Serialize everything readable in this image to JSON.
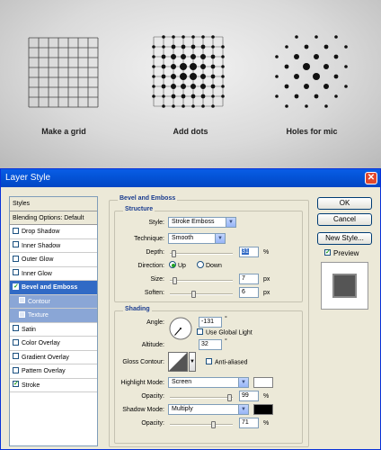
{
  "illustration": {
    "captions": [
      "Make a grid",
      "Add dots",
      "Holes for mic"
    ]
  },
  "dialog": {
    "title": "Layer Style",
    "close_glyph": "✕",
    "styles_list": [
      {
        "label": "Styles",
        "type": "head"
      },
      {
        "label": "Blending Options: Default",
        "type": "head"
      },
      {
        "label": "Drop Shadow",
        "checked": false
      },
      {
        "label": "Inner Shadow",
        "checked": false
      },
      {
        "label": "Outer Glow",
        "checked": false
      },
      {
        "label": "Inner Glow",
        "checked": false
      },
      {
        "label": "Bevel and Emboss",
        "checked": true,
        "selected": true
      },
      {
        "label": "Contour",
        "checked": false,
        "sub": true
      },
      {
        "label": "Texture",
        "checked": false,
        "sub": true
      },
      {
        "label": "Satin",
        "checked": false
      },
      {
        "label": "Color Overlay",
        "checked": false
      },
      {
        "label": "Gradient Overlay",
        "checked": false
      },
      {
        "label": "Pattern Overlay",
        "checked": false
      },
      {
        "label": "Stroke",
        "checked": true
      }
    ],
    "buttons": {
      "ok": "OK",
      "cancel": "Cancel",
      "new_style": "New Style..."
    },
    "preview_label": "Preview",
    "preview_checked": true,
    "bevel": {
      "group_title": "Bevel and Emboss",
      "structure_title": "Structure",
      "style_label": "Style:",
      "style_value": "Stroke Emboss",
      "technique_label": "Technique:",
      "technique_value": "Smooth",
      "depth_label": "Depth:",
      "depth_value": "31",
      "depth_unit": "%",
      "depth_level": 0.03,
      "direction_label": "Direction:",
      "dir_up": "Up",
      "dir_down": "Down",
      "direction_value": "Up",
      "size_label": "Size:",
      "size_value": "7",
      "size_unit": "px",
      "size_level": 0.05,
      "soften_label": "Soften:",
      "soften_value": "6",
      "soften_unit": "px",
      "soften_level": 0.37
    },
    "shading": {
      "title": "Shading",
      "angle_label": "Angle:",
      "angle_value": "-131",
      "angle_unit": "°",
      "global_light_label": "Use Global Light",
      "global_light": false,
      "altitude_label": "Altitude:",
      "altitude_value": "32",
      "altitude_unit": "°",
      "gloss_label": "Gloss Contour:",
      "anti_aliased_label": "Anti-aliased",
      "anti_aliased": false,
      "highlight_label": "Highlight Mode:",
      "highlight_value": "Screen",
      "highlight_color": "#ffffff",
      "hl_opacity_label": "Opacity:",
      "hl_opacity_value": "99",
      "hl_opacity_unit": "%",
      "hl_opacity_level": 0.99,
      "shadow_label": "Shadow Mode:",
      "shadow_value": "Multiply",
      "shadow_color": "#000000",
      "sh_opacity_label": "Opacity:",
      "sh_opacity_value": "71",
      "sh_opacity_unit": "%",
      "sh_opacity_level": 0.71
    }
  }
}
